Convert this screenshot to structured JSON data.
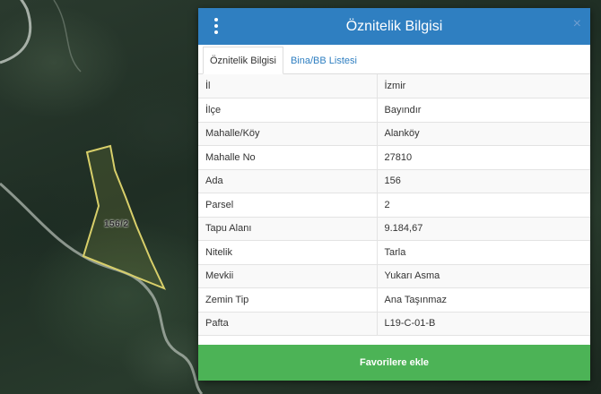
{
  "map": {
    "parcel_label": "156/2"
  },
  "panel": {
    "title": "Öznitelik Bilgisi",
    "close_symbol": "×",
    "menu_icon": "vertical-ellipsis-icon",
    "tabs": [
      {
        "label": "Öznitelik Bilgisi",
        "active": true
      },
      {
        "label": "Bina/BB Listesi",
        "active": false
      }
    ],
    "rows": [
      {
        "key": "İl",
        "value": "İzmir"
      },
      {
        "key": "İlçe",
        "value": "Bayındır"
      },
      {
        "key": "Mahalle/Köy",
        "value": "Alanköy"
      },
      {
        "key": "Mahalle No",
        "value": "27810"
      },
      {
        "key": "Ada",
        "value": "156"
      },
      {
        "key": "Parsel",
        "value": "2"
      },
      {
        "key": "Tapu Alanı",
        "value": "9.184,67"
      },
      {
        "key": "Nitelik",
        "value": "Tarla"
      },
      {
        "key": "Mevkii",
        "value": "Yukarı Asma"
      },
      {
        "key": "Zemin Tip",
        "value": "Ana Taşınmaz"
      },
      {
        "key": "Pafta",
        "value": "L19-C-01-B"
      }
    ],
    "favorite_button": "Favorilere ekle"
  },
  "colors": {
    "header": "#2f7fc1",
    "button": "#4cb356",
    "parcel_outline": "#d8cf6a"
  }
}
